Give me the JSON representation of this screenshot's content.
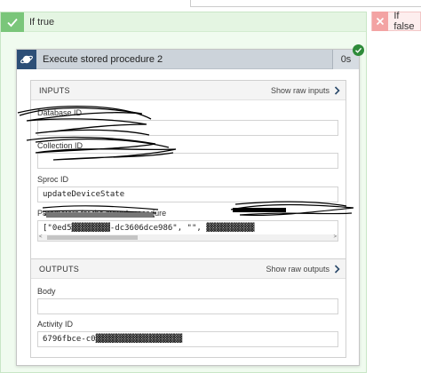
{
  "branches": {
    "true_label": "If true",
    "false_label": "If false"
  },
  "action": {
    "title": "Execute stored procedure 2",
    "duration": "0s",
    "icon": "cosmosdb-planet-icon",
    "status_icon": "success-check-icon"
  },
  "inputs": {
    "title": "INPUTS",
    "raw_link": "Show raw inputs",
    "fields": {
      "database_id": {
        "label": "Database ID",
        "value": ""
      },
      "collection_id": {
        "label": "Collection ID",
        "value": ""
      },
      "sproc_id": {
        "label": "Sproc ID",
        "value": "updateDeviceState"
      },
      "parameters": {
        "label": "Parameters for the stored procedure",
        "value": "[\"0ed5▓▓▓▓▓▓▓▓-dc3606dce986\", \"\", ▓▓▓▓▓▓▓▓▓▓"
      }
    }
  },
  "outputs": {
    "title": "OUTPUTS",
    "raw_link": "Show raw outputs",
    "fields": {
      "body": {
        "label": "Body",
        "value": ""
      },
      "activity_id": {
        "label": "Activity ID",
        "value": "6796fbce-c0▓▓▓▓▓▓▓▓▓▓▓▓▓▓▓▓▓▓"
      }
    }
  },
  "colors": {
    "true_accent": "#7ac67a",
    "false_accent": "#f3a3a3",
    "card_header": "#ccd3da",
    "action_icon_bg": "#2d4f77",
    "success": "#2e8b3a"
  }
}
